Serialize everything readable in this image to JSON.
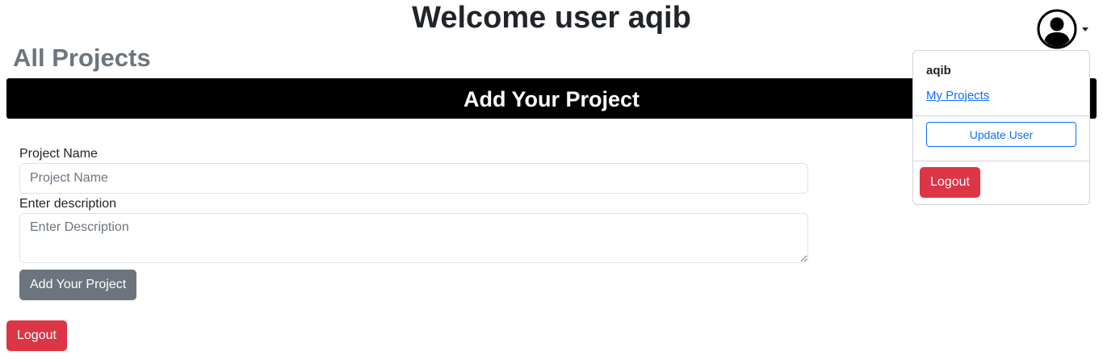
{
  "header": {
    "welcome_text": "Welcome user aqib",
    "section_title": "All Projects",
    "banner_title": "Add Your Project"
  },
  "form": {
    "project_name_label": "Project Name",
    "project_name_placeholder": "Project Name",
    "project_name_value": "",
    "description_label": "Enter description",
    "description_placeholder": "Enter Description",
    "description_value": "",
    "submit_label": "Add Your Project"
  },
  "page_logout_label": "Logout",
  "user_menu": {
    "avatar_icon": "user-circle-icon",
    "username": "aqib",
    "my_projects_label": "My Projects",
    "update_user_label": "Update User",
    "logout_label": "Logout"
  },
  "colors": {
    "banner_bg": "#000000",
    "secondary_button": "#6c757d",
    "danger_button": "#dc3545",
    "link": "#0d6efd",
    "muted_title": "#6c757d"
  }
}
